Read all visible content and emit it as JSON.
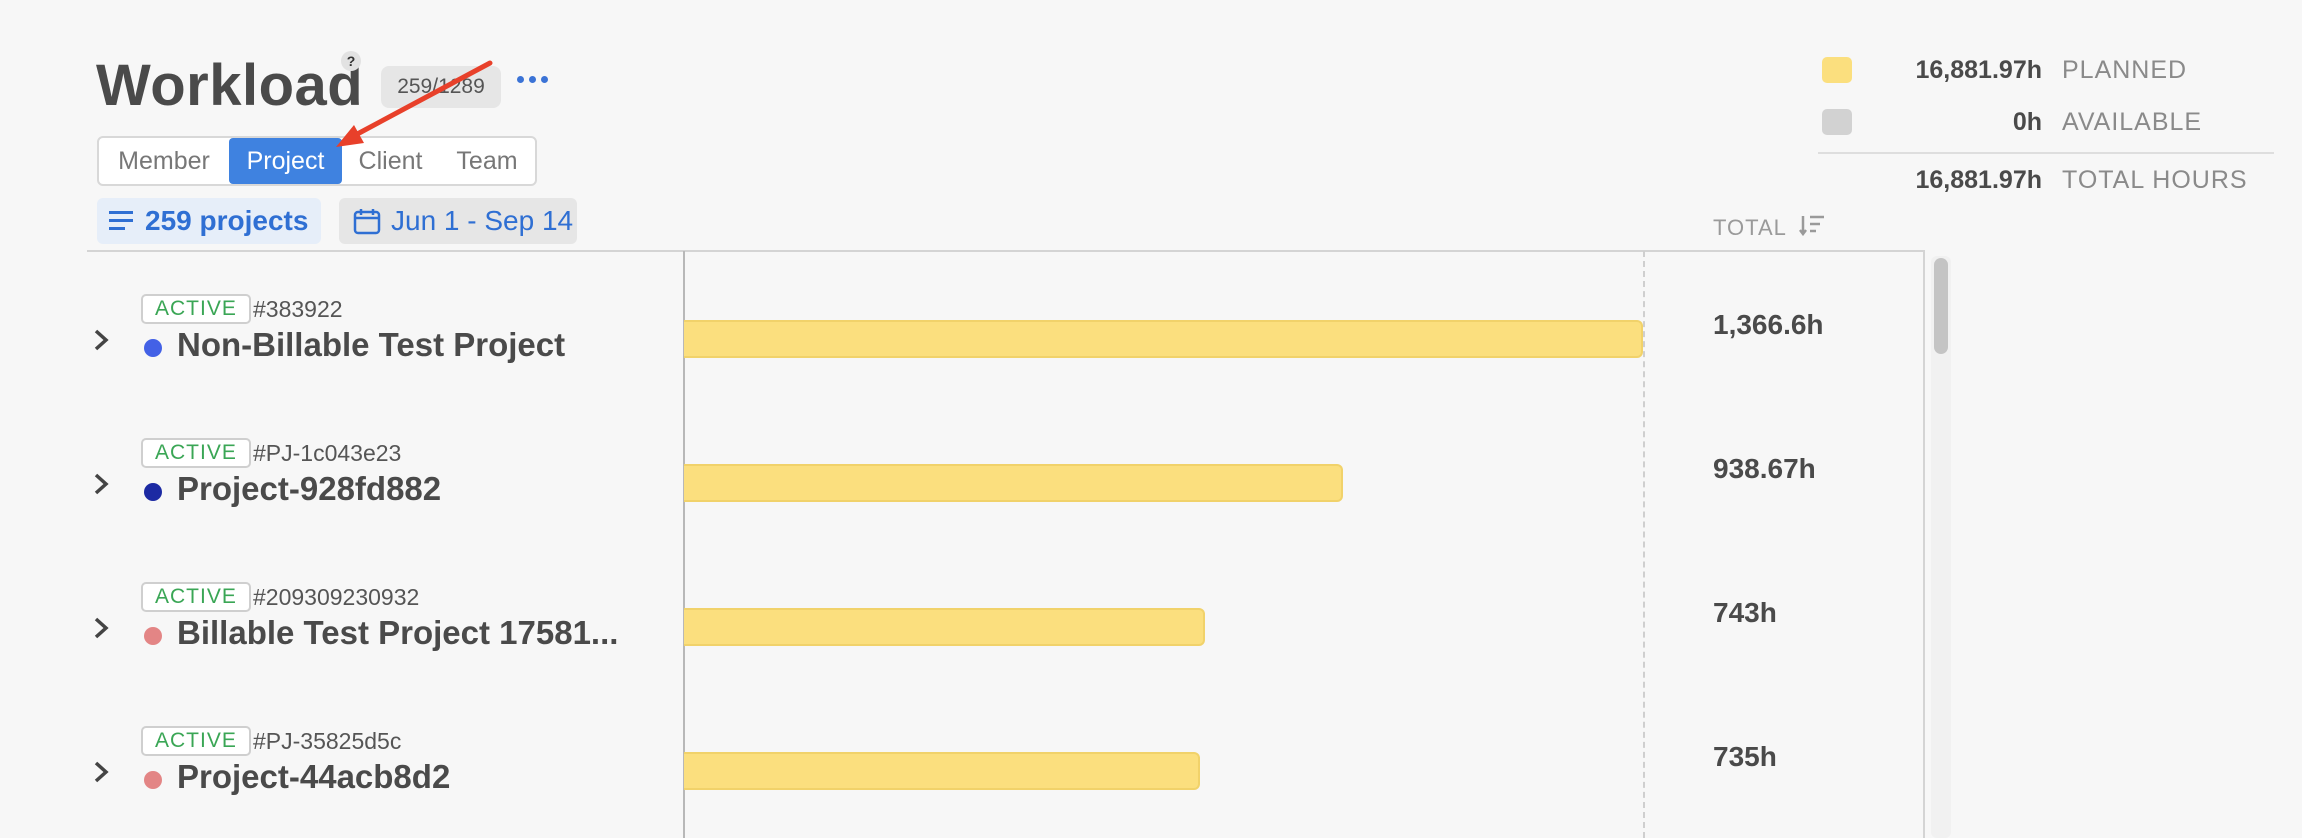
{
  "header": {
    "title": "Workload",
    "help_glyph": "?",
    "count_badge": "259/1289"
  },
  "view_tabs": [
    {
      "label": "Member",
      "active": false
    },
    {
      "label": "Project",
      "active": true
    },
    {
      "label": "Client",
      "active": false
    },
    {
      "label": "Team",
      "active": false
    }
  ],
  "filters": {
    "projects": "259 projects",
    "date_range": "Jun 1 - Sep 14"
  },
  "summary": {
    "planned": {
      "value": "16,881.97h",
      "label": "PLANNED",
      "color": "#fbdf7e"
    },
    "available": {
      "value": "0h",
      "label": "AVAILABLE",
      "color": "#d2d2d2"
    },
    "total": {
      "value": "16,881.97h",
      "label": "TOTAL HOURS"
    }
  },
  "table": {
    "total_header": "TOTAL",
    "max_hours": 1366.6,
    "rows": [
      {
        "status": "ACTIVE",
        "id": "#383922",
        "name": "Non-Billable Test Project",
        "dot_color": "#4361e6",
        "hours": 1366.6,
        "total": "1,366.6h"
      },
      {
        "status": "ACTIVE",
        "id": "#PJ-1c043e23",
        "name": "Project-928fd882",
        "dot_color": "#1c2aa3",
        "hours": 938.67,
        "total": "938.67h"
      },
      {
        "status": "ACTIVE",
        "id": "#209309230932",
        "name": "Billable Test Project 17581...",
        "dot_color": "#e38585",
        "hours": 743,
        "total": "743h"
      },
      {
        "status": "ACTIVE",
        "id": "#PJ-35825d5c",
        "name": "Project-44acb8d2",
        "dot_color": "#e38585",
        "hours": 735,
        "total": "735h"
      }
    ]
  },
  "colors": {
    "accent": "#3f82e0",
    "bar_fill": "#fbdf7e",
    "status_active": "#3aa655",
    "annotation_arrow": "#e8402a"
  }
}
